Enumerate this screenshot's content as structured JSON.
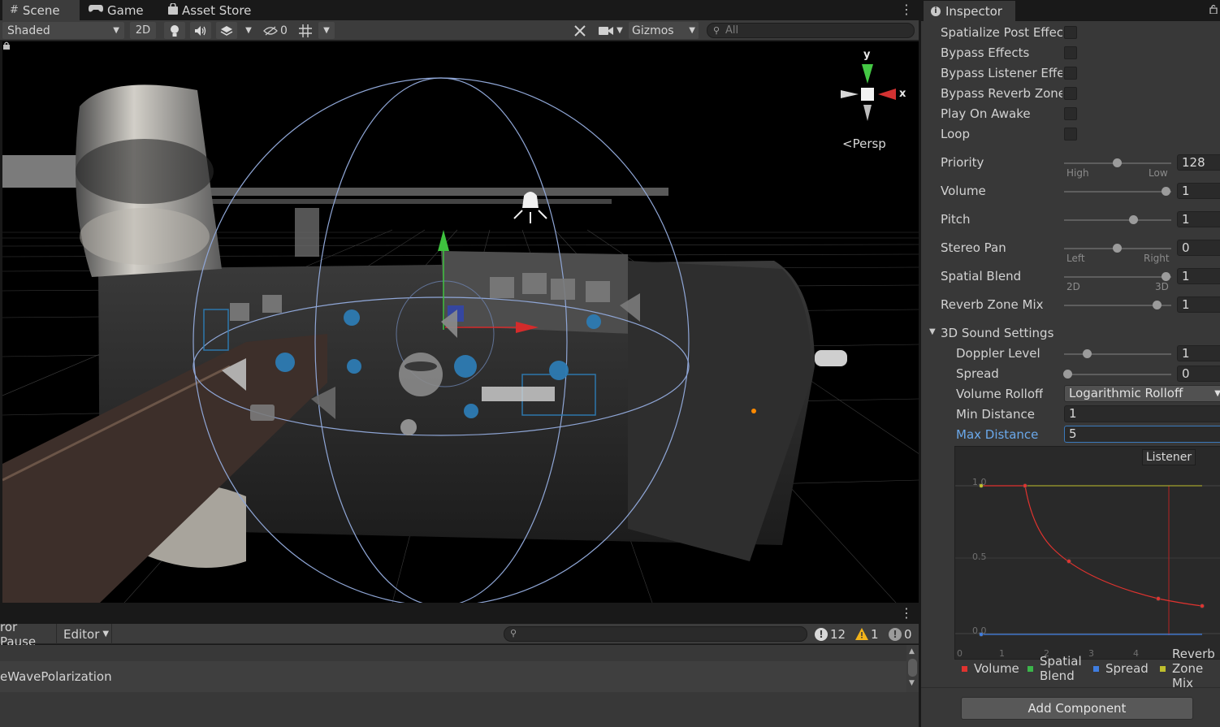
{
  "scene_window": {
    "tabs": [
      {
        "label": "Scene",
        "icon": "hash-icon"
      },
      {
        "label": "Game",
        "icon": "gamepad-icon"
      },
      {
        "label": "Asset Store",
        "icon": "store-bag-icon"
      }
    ],
    "toolbar": {
      "shading_mode": "Shaded",
      "mode_2d": "2D",
      "hidden_count": "0",
      "gizmos_label": "Gizmos",
      "search_placeholder": "All"
    },
    "view_gizmo": {
      "axis_y": "y",
      "axis_x": "x",
      "projection": "Persp"
    }
  },
  "console": {
    "clear_on_label": "ror Pause",
    "editor_label": "Editor",
    "log_count": "12",
    "warning_count": "1",
    "error_count": "0",
    "entries": [
      "eWavePolarization"
    ]
  },
  "inspector": {
    "tab_label": "Inspector",
    "checkbox_props": [
      {
        "label": "Spatialize Post Effects",
        "checked": false
      },
      {
        "label": "Bypass Effects",
        "checked": false
      },
      {
        "label": "Bypass Listener Effects",
        "checked": false
      },
      {
        "label": "Bypass Reverb Zones",
        "checked": false
      },
      {
        "label": "Play On Awake",
        "checked": false
      },
      {
        "label": "Loop",
        "checked": false
      }
    ],
    "sliders": [
      {
        "label": "Priority",
        "value": "128",
        "fraction": 0.5,
        "left": "High",
        "right": "Low"
      },
      {
        "label": "Volume",
        "value": "1",
        "fraction": 1.0
      },
      {
        "label": "Pitch",
        "value": "1",
        "fraction": 0.67
      },
      {
        "label": "Stereo Pan",
        "value": "0",
        "fraction": 0.5,
        "left": "Left",
        "right": "Right"
      },
      {
        "label": "Spatial Blend",
        "value": "1",
        "fraction": 1.0,
        "left": "2D",
        "right": "3D"
      },
      {
        "label": "Reverb Zone Mix",
        "value": "1",
        "fraction": 0.91
      }
    ],
    "sound_3d": {
      "header": "3D Sound Settings",
      "doppler_label": "Doppler Level",
      "doppler_value": "1",
      "doppler_fraction": 0.2,
      "spread_label": "Spread",
      "spread_value": "0",
      "spread_fraction": 0.0,
      "rolloff_label": "Volume Rolloff",
      "rolloff_value": "Logarithmic Rolloff",
      "min_distance_label": "Min Distance",
      "min_distance_value": "1",
      "max_distance_label": "Max Distance",
      "max_distance_value": "5"
    },
    "curve": {
      "listener_label": "Listener",
      "y_ticks": [
        "1.0",
        "0.5",
        "0.0"
      ],
      "x_ticks": [
        "0",
        "1",
        "2",
        "3",
        "4"
      ],
      "legend": [
        {
          "label": "Volume",
          "color": "#e0332f"
        },
        {
          "label": "Spatial Blend",
          "color": "#3bb54a"
        },
        {
          "label": "Spread",
          "color": "#3f7de0"
        },
        {
          "label": "Reverb Zone Mix",
          "color": "#bfbf2d"
        }
      ]
    },
    "add_component_label": "Add Component"
  }
}
